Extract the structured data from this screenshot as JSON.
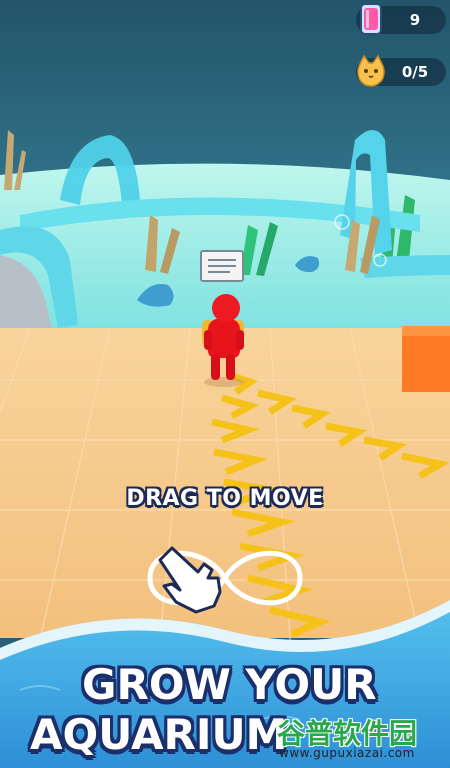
{
  "hud": {
    "potion_count": "9",
    "cat_progress": "0/5"
  },
  "hint": {
    "text": "DRAG TO MOVE"
  },
  "banner": {
    "line1": "GROW YOUR",
    "line2": "AQUARIUM"
  },
  "watermark": {
    "title": "谷普软件园",
    "url": "www.gupuxiazai.com"
  },
  "colors": {
    "water": "#2a5f75",
    "glass": "#5fd7e8",
    "sand": "#f4c98a",
    "player": "#e8141c",
    "arrow": "#f5c21a",
    "banner_text_outline": "#1a2f6b",
    "pool_water": "#39a9e0"
  }
}
